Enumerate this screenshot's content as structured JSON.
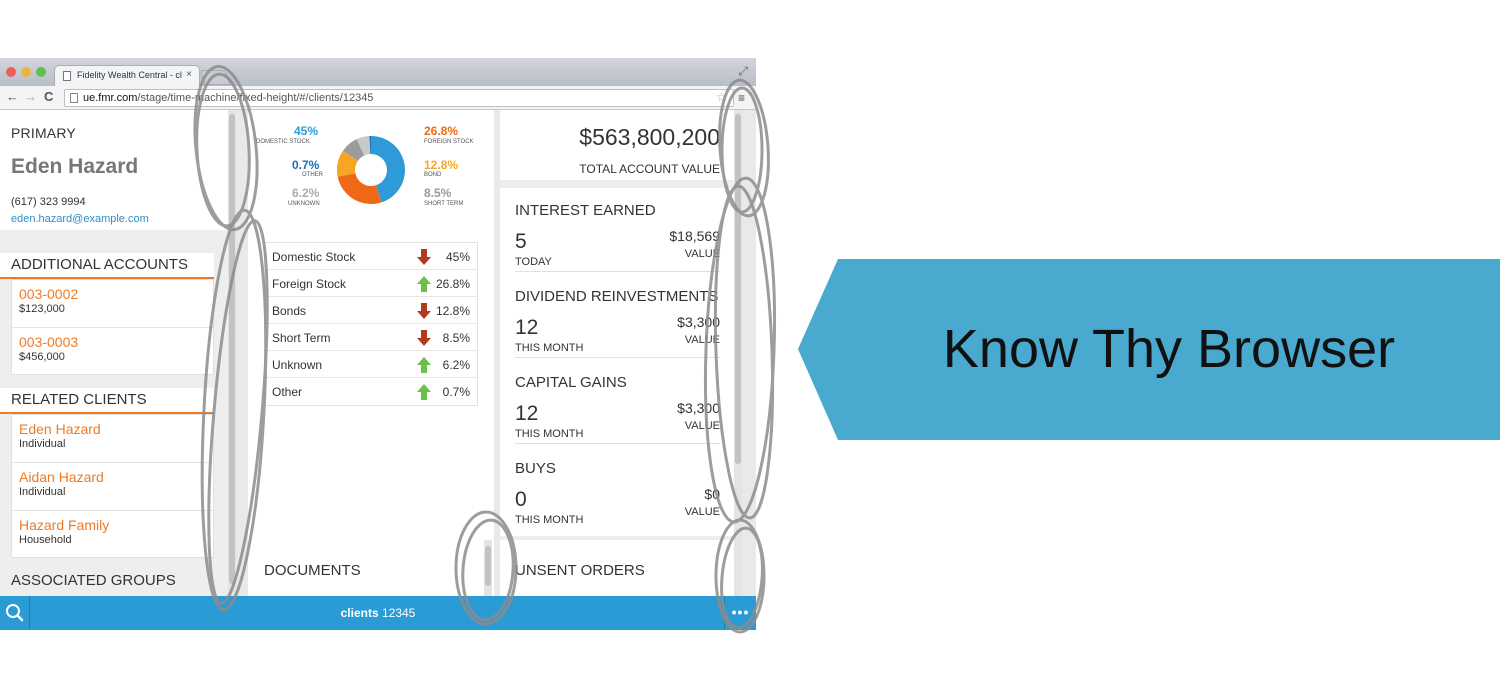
{
  "browser": {
    "tab_title": "Fidelity Wealth Central - cl",
    "tab_close": "×",
    "url_domain": "ue.fmr.com",
    "url_path": "/stage/time-machine/fixed-height/#/clients/12345",
    "back": "←",
    "forward": "→",
    "reload": "C",
    "star": "☆",
    "menu": "≡",
    "window_ctrl": "⤢"
  },
  "client": {
    "label": "PRIMARY",
    "name": "Eden Hazard",
    "phone": "(617) 323 9994",
    "email": "eden.hazard@example.com"
  },
  "additional_accounts": {
    "heading": "ADDITIONAL ACCOUNTS",
    "items": [
      {
        "id": "003-0002",
        "value": "$123,000"
      },
      {
        "id": "003-0003",
        "value": "$456,000"
      }
    ]
  },
  "related_clients": {
    "heading": "RELATED CLIENTS",
    "items": [
      {
        "name": "Eden Hazard",
        "type": "Individual"
      },
      {
        "name": "Aidan Hazard",
        "type": "Individual"
      },
      {
        "name": "Hazard Family",
        "type": "Household"
      }
    ]
  },
  "associated_groups": {
    "heading": "ASSOCIATED GROUPS"
  },
  "allocation_legend": {
    "domestic": {
      "pct": "45%",
      "label": "DOMESTIC STOCK"
    },
    "other": {
      "pct": "0.7%",
      "label": "OTHER"
    },
    "unknown": {
      "pct": "6.2%",
      "label": "UNKNOWN"
    },
    "foreign": {
      "pct": "26.8%",
      "label": "FOREIGN STOCK"
    },
    "bond": {
      "pct": "12.8%",
      "label": "BOND"
    },
    "short": {
      "pct": "8.5%",
      "label": "SHORT TERM"
    }
  },
  "allocation_rows": [
    {
      "name": "Domestic Stock",
      "direction": "down",
      "value": "45%"
    },
    {
      "name": "Foreign Stock",
      "direction": "up",
      "value": "26.8%"
    },
    {
      "name": "Bonds",
      "direction": "down",
      "value": "12.8%"
    },
    {
      "name": "Short Term",
      "direction": "down",
      "value": "8.5%"
    },
    {
      "name": "Unknown",
      "direction": "up",
      "value": "6.2%"
    },
    {
      "name": "Other",
      "direction": "up",
      "value": "0.7%"
    }
  ],
  "documents": {
    "heading": "DOCUMENTS"
  },
  "account_total": {
    "amount": "$563,800,200",
    "label": "TOTAL ACCOUNT VALUE"
  },
  "stats": [
    {
      "heading": "INTEREST EARNED",
      "count": "5",
      "period": "TODAY",
      "amount": "$18,569",
      "value_label": "VALUE"
    },
    {
      "heading": "DIVIDEND REINVESTMENTS",
      "count": "12",
      "period": "THIS MONTH",
      "amount": "$3,300",
      "value_label": "VALUE"
    },
    {
      "heading": "CAPITAL GAINS",
      "count": "12",
      "period": "THIS MONTH",
      "amount": "$3,300",
      "value_label": "VALUE"
    },
    {
      "heading": "BUYS",
      "count": "0",
      "period": "THIS MONTH",
      "amount": "$0",
      "value_label": "VALUE"
    }
  ],
  "unsent_orders": {
    "heading": "UNSENT ORDERS"
  },
  "bottom_bar": {
    "section": "clients",
    "client_id": "12345",
    "more": "•••"
  },
  "callout": {
    "text": "Know Thy Browser",
    "color": "#4aa9cf"
  },
  "colors": {
    "accent": "#f07a21",
    "link": "#2f8fc7",
    "bar": "#2a9bd4",
    "up": "#6cc04a",
    "down": "#b23a1f"
  },
  "donut_segments": [
    {
      "name": "Domestic Stock",
      "value": 45,
      "color": "#2f9ad8"
    },
    {
      "name": "Foreign Stock",
      "value": 26.8,
      "color": "#ef6a16"
    },
    {
      "name": "Bond",
      "value": 12.8,
      "color": "#f6a623"
    },
    {
      "name": "Short Term",
      "value": 8.5,
      "color": "#9b9b9b"
    },
    {
      "name": "Unknown",
      "value": 6.2,
      "color": "#c9c9c9"
    },
    {
      "name": "Other",
      "value": 0.7,
      "color": "#1c6fb2"
    }
  ]
}
